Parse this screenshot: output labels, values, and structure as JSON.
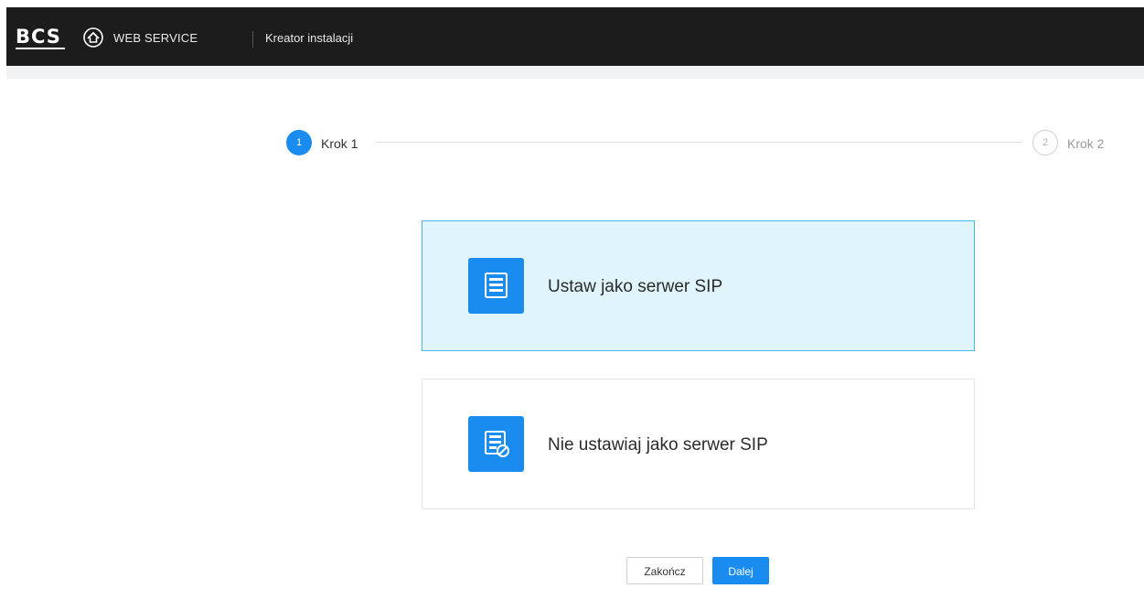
{
  "header": {
    "logo_text": "BCS",
    "brand_text": "WEB SERVICE",
    "page_title": "Kreator instalacji"
  },
  "stepper": {
    "steps": [
      {
        "number": "1",
        "label": "Krok 1",
        "state": "active"
      },
      {
        "number": "2",
        "label": "Krok 2",
        "state": "inactive"
      }
    ]
  },
  "options": [
    {
      "label": "Ustaw jako serwer SIP",
      "icon": "server-icon",
      "selected": true
    },
    {
      "label": "Nie ustawiaj jako serwer SIP",
      "icon": "server-disabled-icon",
      "selected": false
    }
  ],
  "footer": {
    "finish_label": "Zakończ",
    "next_label": "Dalej"
  },
  "colors": {
    "accent": "#1a8cf0",
    "selected_bg": "#dff5fb",
    "selected_border": "#43b6ea",
    "header_bg": "#1c1c1c"
  }
}
